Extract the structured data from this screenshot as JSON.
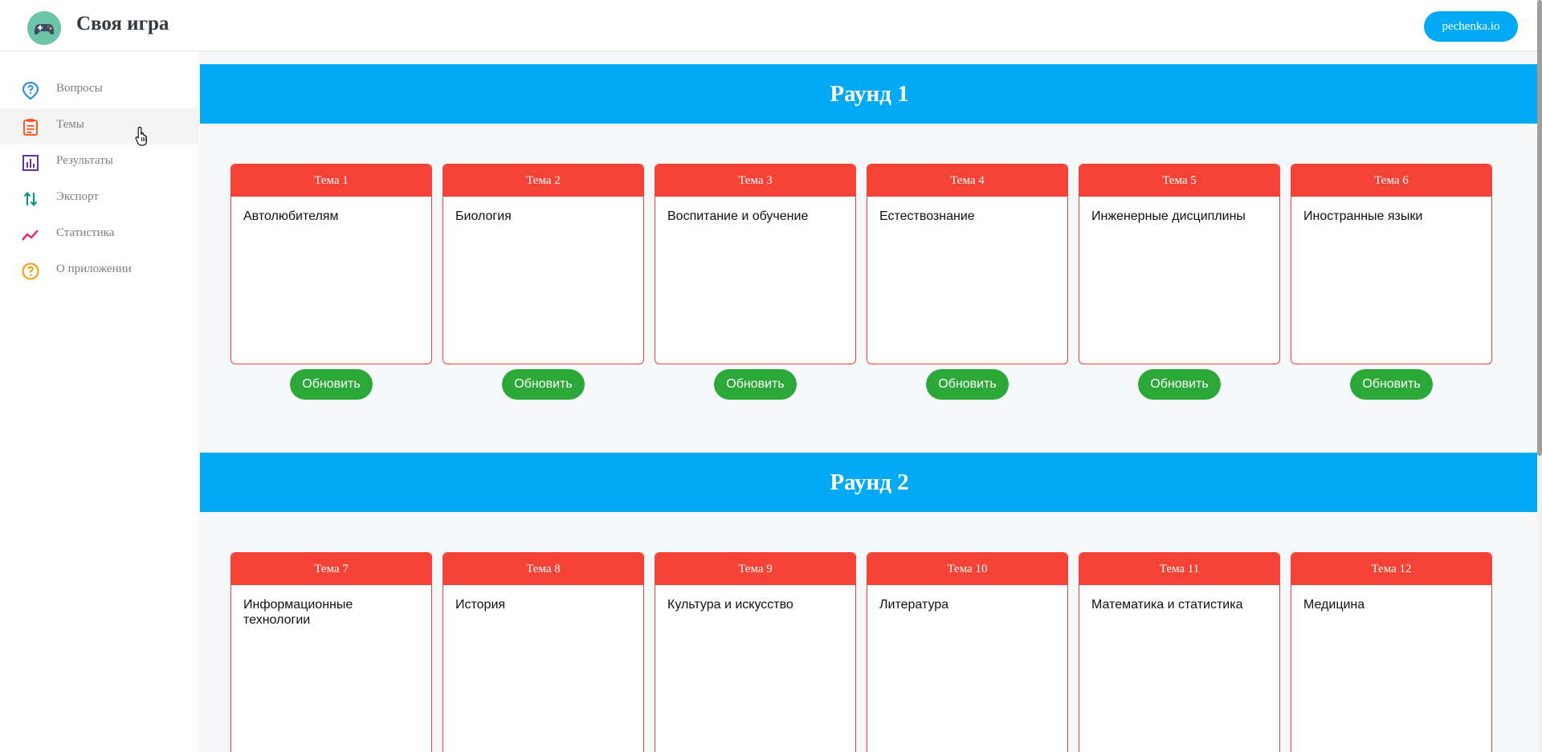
{
  "header": {
    "title": "Своя игра",
    "user_button": "pechenka.io",
    "logo_icon": "gamepad-icon"
  },
  "sidebar": {
    "items": [
      {
        "label": "Вопросы",
        "icon": "question-pin-icon",
        "color": "#1e88e5"
      },
      {
        "label": "Темы",
        "icon": "clipboard-icon",
        "color": "#ff5722"
      },
      {
        "label": "Результаты",
        "icon": "bar-chart-icon",
        "color": "#5e35b1"
      },
      {
        "label": "Экспорт",
        "icon": "swap-vert-icon",
        "color": "#009688"
      },
      {
        "label": "Статистика",
        "icon": "trend-line-icon",
        "color": "#e91e63"
      },
      {
        "label": "О приложении",
        "icon": "help-circle-icon",
        "color": "#ff9800"
      }
    ],
    "active_index": 1
  },
  "rounds": [
    {
      "title": "Раунд 1",
      "topics": [
        {
          "header": "Тема 1",
          "name": "Автолюбителям",
          "button": "Обновить"
        },
        {
          "header": "Тема 2",
          "name": "Биология",
          "button": "Обновить"
        },
        {
          "header": "Тема 3",
          "name": "Воспитание и обучение",
          "button": "Обновить"
        },
        {
          "header": "Тема 4",
          "name": "Естествознание",
          "button": "Обновить"
        },
        {
          "header": "Тема 5",
          "name": "Инженерные дисциплины",
          "button": "Обновить"
        },
        {
          "header": "Тема 6",
          "name": "Иностранные языки",
          "button": "Обновить"
        }
      ]
    },
    {
      "title": "Раунд 2",
      "topics": [
        {
          "header": "Тема 7",
          "name": "Информационные технологии"
        },
        {
          "header": "Тема 8",
          "name": "История"
        },
        {
          "header": "Тема 9",
          "name": "Культура и искусство"
        },
        {
          "header": "Тема 10",
          "name": "Литература"
        },
        {
          "header": "Тема 11",
          "name": "Математика и статистика"
        },
        {
          "header": "Тема 12",
          "name": "Медицина"
        }
      ]
    }
  ],
  "colors": {
    "accent": "#03a9f4",
    "topic": "#f44336",
    "button": "#2ba837"
  }
}
